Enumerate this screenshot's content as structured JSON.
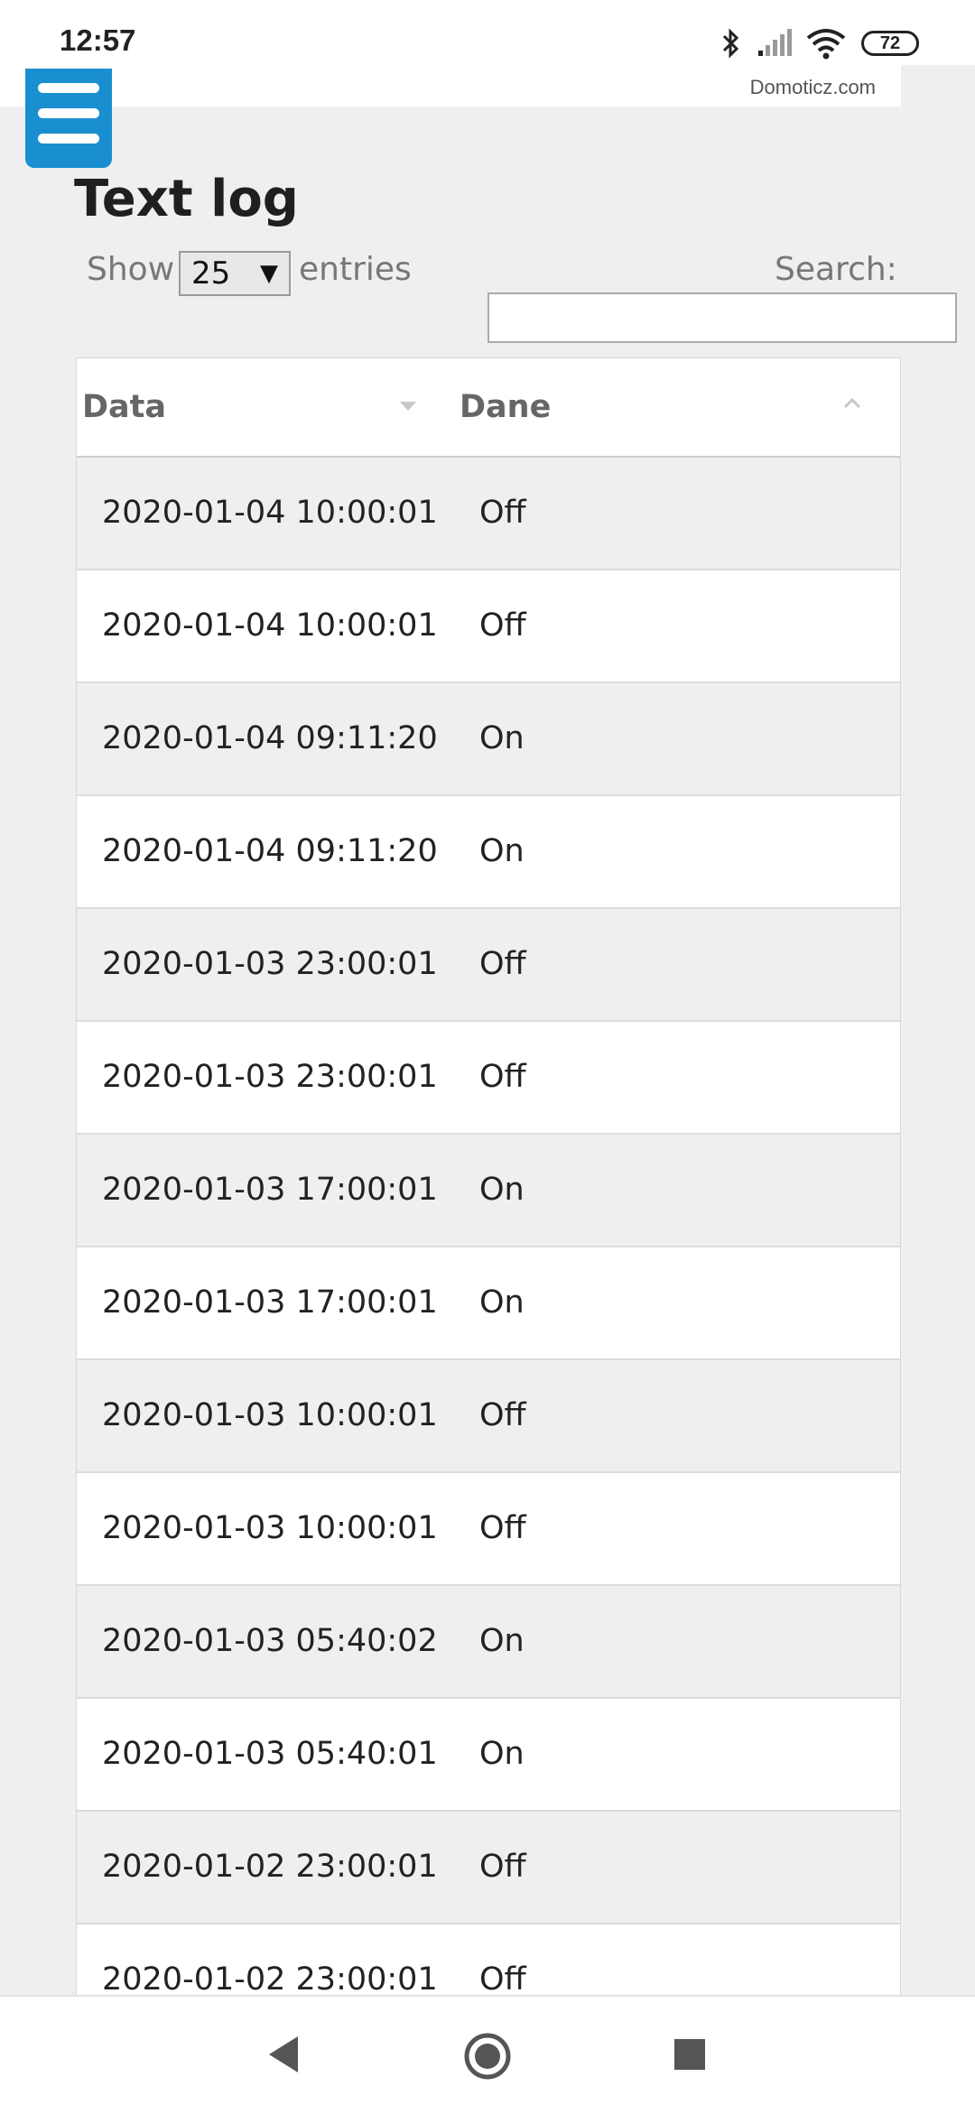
{
  "status_bar": {
    "time": "12:57",
    "battery": "72",
    "icons": [
      "bluetooth-icon",
      "cell-signal-icon",
      "wifi-icon",
      "battery-icon"
    ]
  },
  "brand": "Domoticz.com",
  "menu_icon": "hamburger-menu-icon",
  "page_title": "Text log",
  "length_control": {
    "show_label": "Show",
    "selected": "25",
    "entries_label": "entries"
  },
  "search": {
    "label": "Search:",
    "value": ""
  },
  "table": {
    "columns": [
      "Data",
      "Dane"
    ],
    "rows": [
      {
        "date": "2020-01-04 10:00:01",
        "value": "Off"
      },
      {
        "date": "2020-01-04 10:00:01",
        "value": "Off"
      },
      {
        "date": "2020-01-04 09:11:20",
        "value": "On"
      },
      {
        "date": "2020-01-04 09:11:20",
        "value": "On"
      },
      {
        "date": "2020-01-03 23:00:01",
        "value": "Off"
      },
      {
        "date": "2020-01-03 23:00:01",
        "value": "Off"
      },
      {
        "date": "2020-01-03 17:00:01",
        "value": "On"
      },
      {
        "date": "2020-01-03 17:00:01",
        "value": "On"
      },
      {
        "date": "2020-01-03 10:00:01",
        "value": "Off"
      },
      {
        "date": "2020-01-03 10:00:01",
        "value": "Off"
      },
      {
        "date": "2020-01-03 05:40:02",
        "value": "On"
      },
      {
        "date": "2020-01-03 05:40:01",
        "value": "On"
      },
      {
        "date": "2020-01-02 23:00:01",
        "value": "Off"
      },
      {
        "date": "2020-01-02 23:00:01",
        "value": "Off"
      }
    ]
  },
  "nav_bar": {
    "icons": [
      "back-icon",
      "home-icon",
      "recents-icon"
    ]
  },
  "colors": {
    "accent": "#1a8fd0",
    "row_alt": "#efefef",
    "page_bg": "#efefef"
  }
}
